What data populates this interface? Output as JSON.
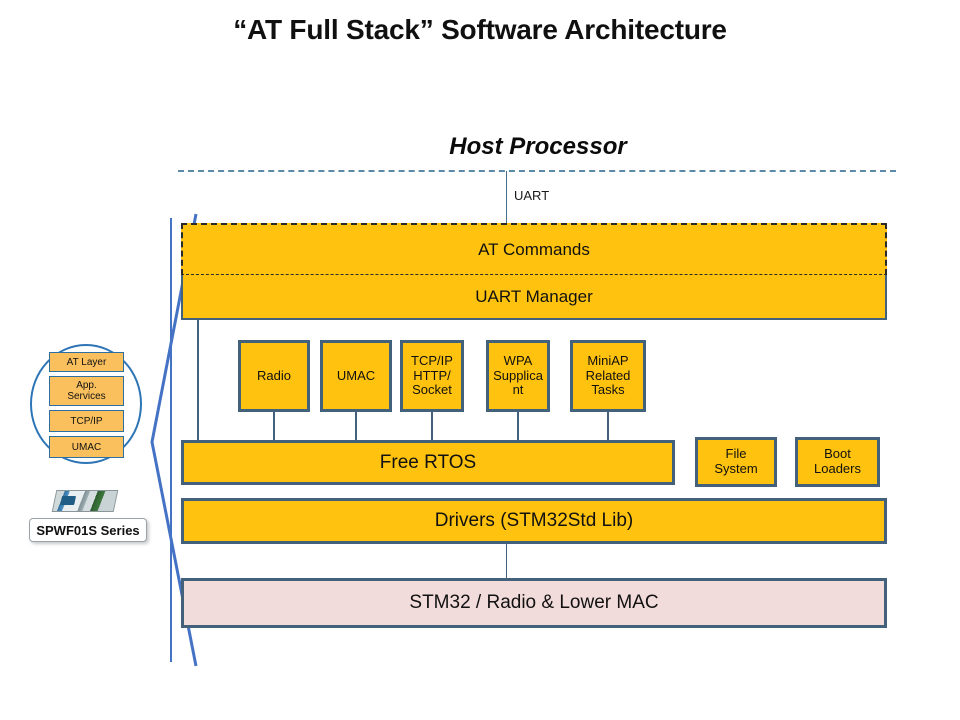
{
  "title": "“AT Full Stack” Software Architecture",
  "diagram": {
    "host": {
      "label": "Host Processor",
      "interface_label": "UART"
    },
    "stack": {
      "at_commands": "AT Commands",
      "uart_manager": "UART Manager",
      "tasks": [
        {
          "label": "Radio"
        },
        {
          "label": "UMAC"
        },
        {
          "label": "TCP/IP\nHTTP/\nSocket"
        },
        {
          "label": "WPA\nSupplica\nnt"
        },
        {
          "label": "MiniAP\nRelated\nTasks"
        }
      ],
      "free_rtos": "Free RTOS",
      "file_system": "File\nSystem",
      "boot_loaders": "Boot\nLoaders",
      "drivers": "Drivers (STM32Std  Lib)",
      "hardware": "STM32 / Radio & Lower MAC"
    },
    "sidebar": {
      "layers": [
        {
          "label": "AT Layer"
        },
        {
          "label": "App.\nServices"
        },
        {
          "label": "TCP/IP"
        },
        {
          "label": "UMAC"
        }
      ],
      "product_label": "SPWF01S Series"
    },
    "colors": {
      "block_fill": "#FFC20E",
      "block_border": "#44617B",
      "hardware_fill": "#F2DCDB",
      "bracket": "#4472C4",
      "divider": "#5B8AA8",
      "mini_fill": "#FAC05E",
      "ellipse": "#2E75B6"
    }
  }
}
